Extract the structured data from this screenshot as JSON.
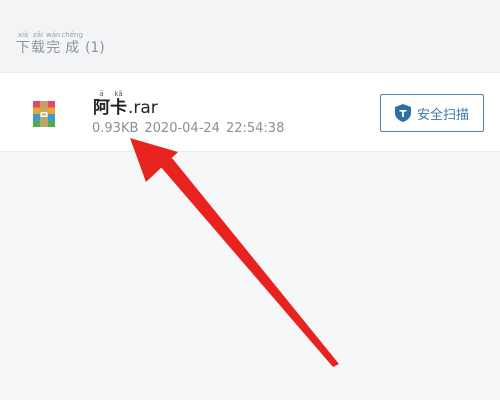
{
  "section": {
    "title_chars": [
      {
        "hz": "下",
        "py": "xià"
      },
      {
        "hz": "载",
        "py": "zǎi"
      },
      {
        "hz": "完",
        "py": "wán"
      },
      {
        "hz": "成",
        "py": "chéng"
      }
    ],
    "count": "(1)"
  },
  "file": {
    "name_chars": [
      {
        "hz": "阿",
        "py": "ā"
      },
      {
        "hz": "卡",
        "py": "kǎ"
      }
    ],
    "extension": ".rar",
    "size": "0.93KB",
    "date": "2020-04-24",
    "time": "22:54:38",
    "icon": "winrar-archive-icon"
  },
  "scan_button": {
    "label": "安全扫描",
    "icon": "shield-icon"
  },
  "colors": {
    "accent": "#3a7ab0",
    "arrow": "#e8231f"
  }
}
